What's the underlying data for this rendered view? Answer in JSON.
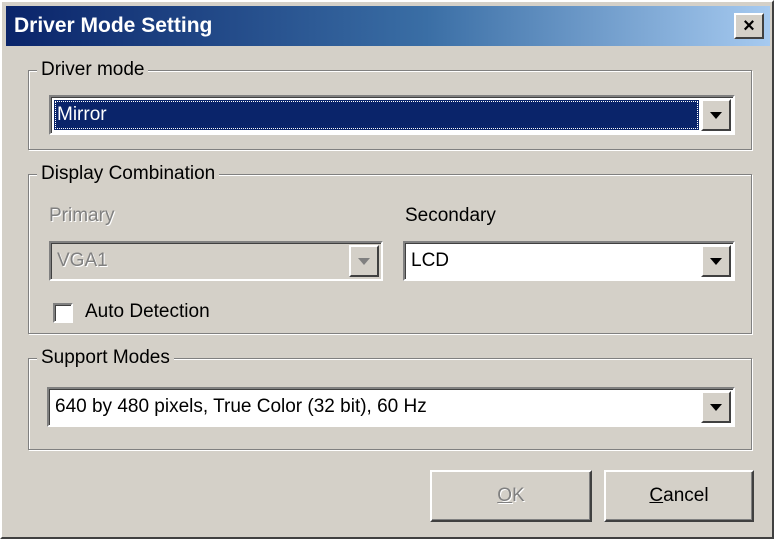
{
  "window": {
    "title": "Driver Mode Setting",
    "close_glyph": "×"
  },
  "driver_mode": {
    "legend": "Driver mode",
    "value": "Mirror"
  },
  "display_combination": {
    "legend": "Display Combination",
    "primary_label": "Primary",
    "primary_value": "VGA1",
    "secondary_label": "Secondary",
    "secondary_value": "LCD",
    "auto_detection_label": "Auto Detection",
    "auto_detection_checked": false
  },
  "support_modes": {
    "legend": "Support Modes",
    "value": "640 by 480 pixels, True Color (32 bit), 60 Hz"
  },
  "buttons": {
    "ok_mnemonic": "O",
    "ok_rest": "K",
    "cancel_mnemonic": "C",
    "cancel_rest": "ancel"
  },
  "icons": {
    "close": "close-icon",
    "dropdown": "chevron-down-icon"
  },
  "colors": {
    "title_start": "#0a246a",
    "title_end": "#a6caf0",
    "selection": "#0a246a",
    "face": "#d4d0c8"
  }
}
